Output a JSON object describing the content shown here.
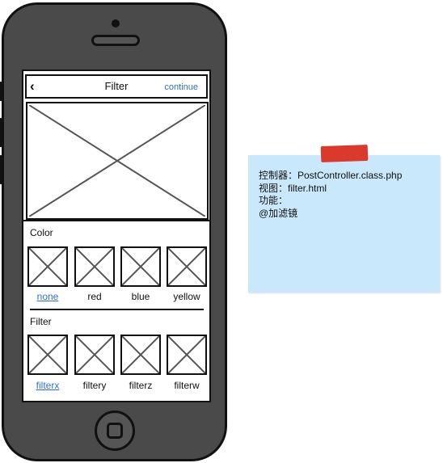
{
  "navbar": {
    "back_icon": "chevron-left-icon",
    "back_glyph": "‹",
    "title": "Filter",
    "continue_label": "continue"
  },
  "color_section": {
    "title": "Color",
    "items": [
      {
        "label": "none",
        "selected": true
      },
      {
        "label": "red",
        "selected": false
      },
      {
        "label": "blue",
        "selected": false
      },
      {
        "label": "yellow",
        "selected": false
      }
    ]
  },
  "filter_section": {
    "title": "Filter",
    "items": [
      {
        "label": "filterx",
        "selected": true
      },
      {
        "label": "filtery",
        "selected": false
      },
      {
        "label": "filterz",
        "selected": false
      },
      {
        "label": "filterw",
        "selected": false
      }
    ]
  },
  "note": {
    "lines": [
      "控制器：PostController.class.php",
      "视图：filter.html",
      "功能：",
      "@加滤镜"
    ]
  },
  "colors": {
    "link": "#2e6fd6",
    "note_bg": "#c9e8fb",
    "tape": "#d93a2b",
    "phone_body": "#4a4a4a"
  }
}
